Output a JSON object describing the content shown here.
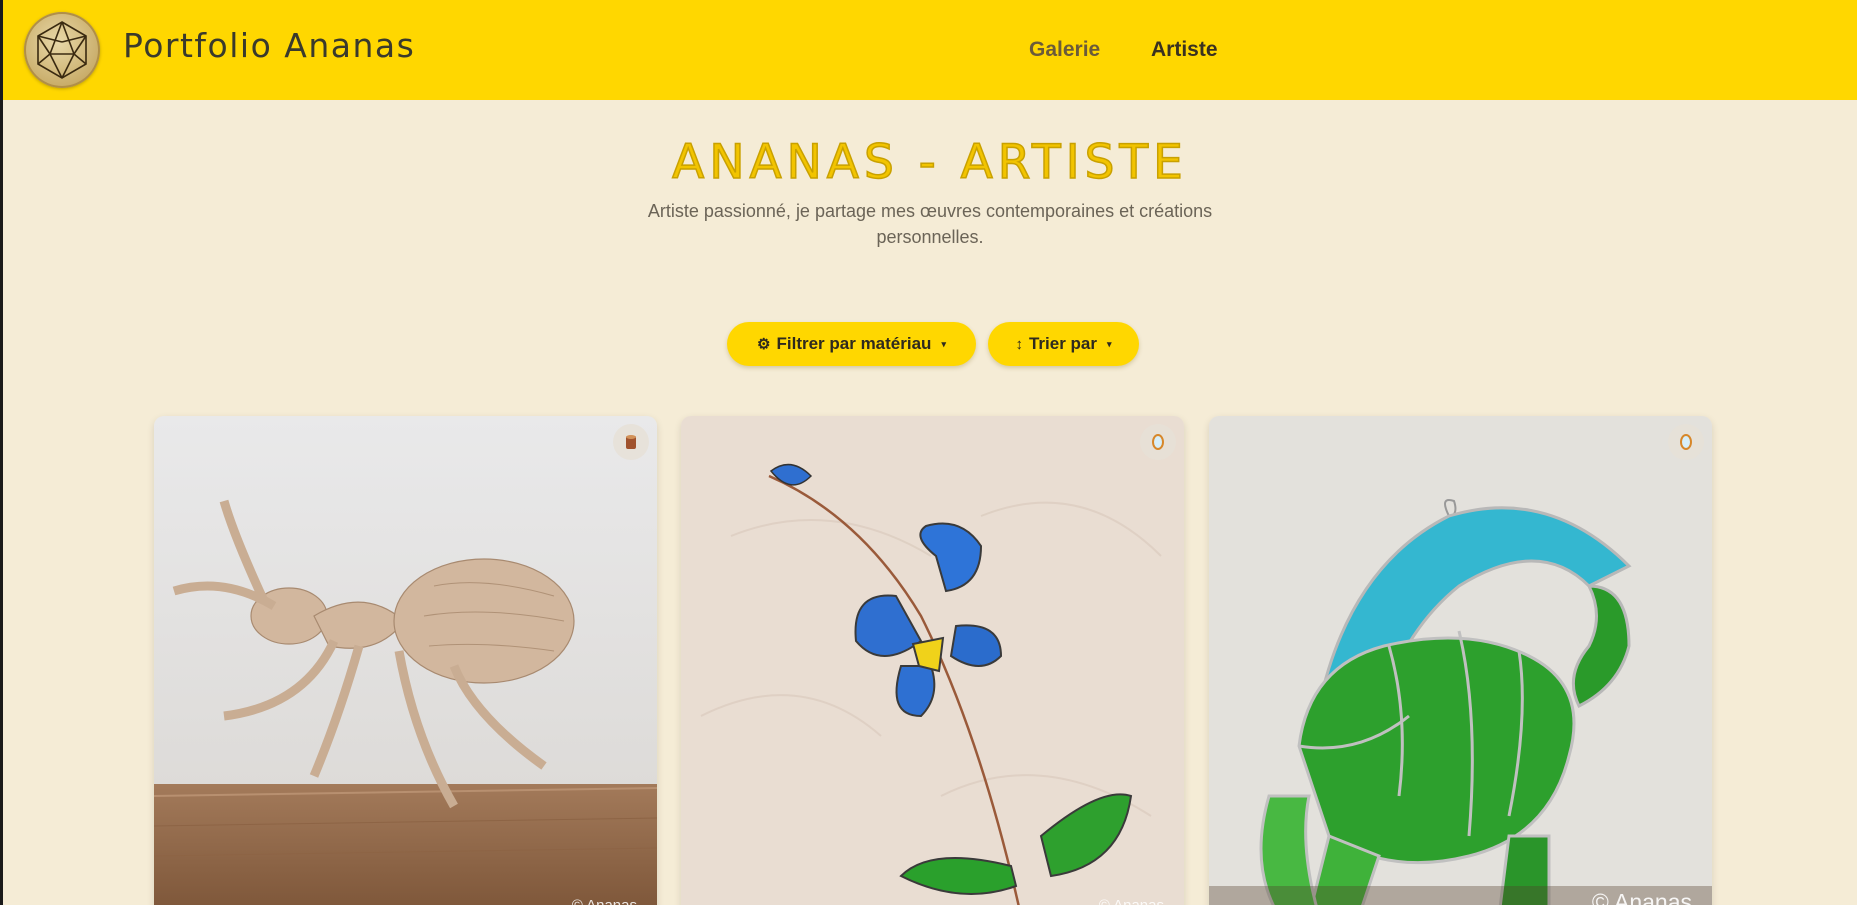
{
  "header": {
    "brand": "Portfolio Ananas",
    "nav": [
      {
        "label": "Galerie"
      },
      {
        "label": "Artiste"
      }
    ]
  },
  "main": {
    "title": "ANANAS - ARTISTE",
    "subtitle": "Artiste passionné, je partage mes œuvres contemporaines et créations personnelles."
  },
  "controls": {
    "filter": {
      "icon": "⚙",
      "label": "Filtrer par matériau",
      "caret": "▾"
    },
    "sort": {
      "icon": "↕",
      "label": "Trier par",
      "caret": "▾"
    }
  },
  "cards": [
    {
      "subject": "wooden ant sculpture",
      "material_icon": "wood-log-icon",
      "watermark": "© Ananas"
    },
    {
      "subject": "stained glass blue flower",
      "material_icon": "mirror-icon",
      "watermark": "© Ananas"
    },
    {
      "subject": "stained glass green dinosaur",
      "material_icon": "mirror-icon",
      "watermark": "© Ananas"
    }
  ],
  "colors": {
    "header_bg": "#ffd700",
    "page_bg": "#f5ecd6",
    "title": "#f2c400",
    "button_bg": "#ffd700"
  }
}
